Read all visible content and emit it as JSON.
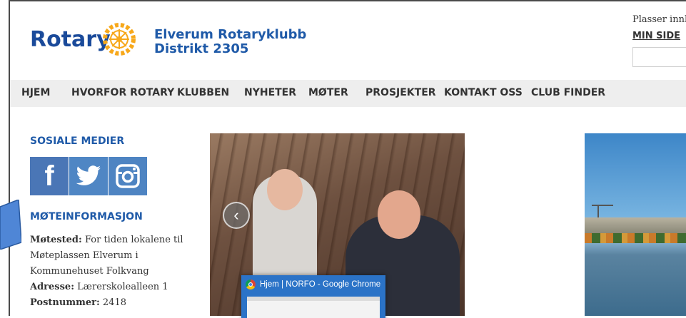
{
  "header": {
    "logo_text": "Rotary",
    "club_name": "Elverum Rotaryklubb",
    "district": "Distrikt 2305",
    "search_hint": "Plasser innh",
    "my_page_link": "MIN SIDE"
  },
  "nav": {
    "items": [
      "HJEM",
      "HVORFOR ROTARY",
      "KLUBBEN",
      "NYHETER",
      "MØTER",
      "PROSJEKTER",
      "KONTAKT OSS",
      "CLUB FINDER"
    ]
  },
  "sidebar": {
    "social_heading": "SOSIALE MEDIER",
    "social_links": [
      "facebook-icon",
      "twitter-icon",
      "instagram-icon"
    ],
    "meeting_heading": "MØTEINFORMASJON",
    "meeting_place_label": "Møtested:",
    "meeting_place_value": "For tiden lokalene til Møteplassen Elverum i Kommunehuset Folkvang",
    "address_label": "Adresse:",
    "address_value": "Lærerskolealleen 1",
    "postal_label": "Postnummer:",
    "postal_value": "2418"
  },
  "slideshow": {
    "prev_button_icon": "chevron-left-icon"
  },
  "taskbar_preview": {
    "title": "Hjem | NORFO - Google Chrome"
  },
  "colors": {
    "brand_blue": "#1f5aa8",
    "nav_bg": "#eeeeee",
    "social_blue": "#4a76b6"
  }
}
